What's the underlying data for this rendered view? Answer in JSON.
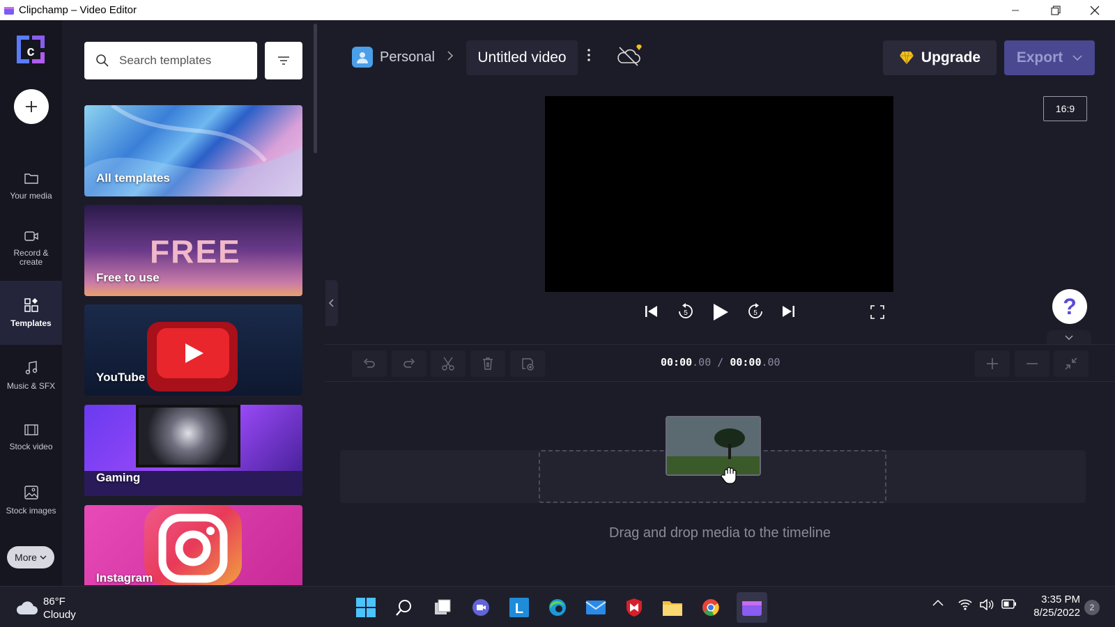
{
  "window": {
    "title": "Clipchamp – Video Editor"
  },
  "rail": {
    "create_label": "+",
    "items": [
      {
        "label": "Your media",
        "icon": "folder-icon"
      },
      {
        "label": "Record & create",
        "icon": "camera-icon"
      },
      {
        "label": "Templates",
        "icon": "templates-icon",
        "active": true
      },
      {
        "label": "Music & SFX",
        "icon": "music-icon"
      },
      {
        "label": "Stock video",
        "icon": "film-icon"
      },
      {
        "label": "Stock images",
        "icon": "image-icon"
      }
    ],
    "more_label": "More"
  },
  "panel": {
    "search_placeholder": "Search templates",
    "cards": [
      {
        "label": "All templates"
      },
      {
        "label": "Free to use",
        "art_text": "FREE"
      },
      {
        "label": "YouTube"
      },
      {
        "label": "Gaming"
      },
      {
        "label": "Instagram"
      }
    ]
  },
  "header": {
    "workspace": "Personal",
    "project_title": "Untitled video",
    "upgrade_label": "Upgrade",
    "export_label": "Export",
    "aspect_ratio": "16:9",
    "help_label": "?"
  },
  "timeline": {
    "current_time_main": "00:00",
    "current_time_frac": ".00",
    "separator": "/",
    "total_time_main": "00:00",
    "total_time_frac": ".00",
    "drop_hint": "Drag and drop media to the timeline"
  },
  "taskbar": {
    "temperature": "86°F",
    "condition": "Cloudy",
    "time": "3:35 PM",
    "date": "8/25/2022",
    "notification_count": "2"
  },
  "colors": {
    "accent": "#4a4890",
    "background": "#1c1c28",
    "rail_bg": "#161620",
    "help_icon": "#5b4bd8"
  }
}
